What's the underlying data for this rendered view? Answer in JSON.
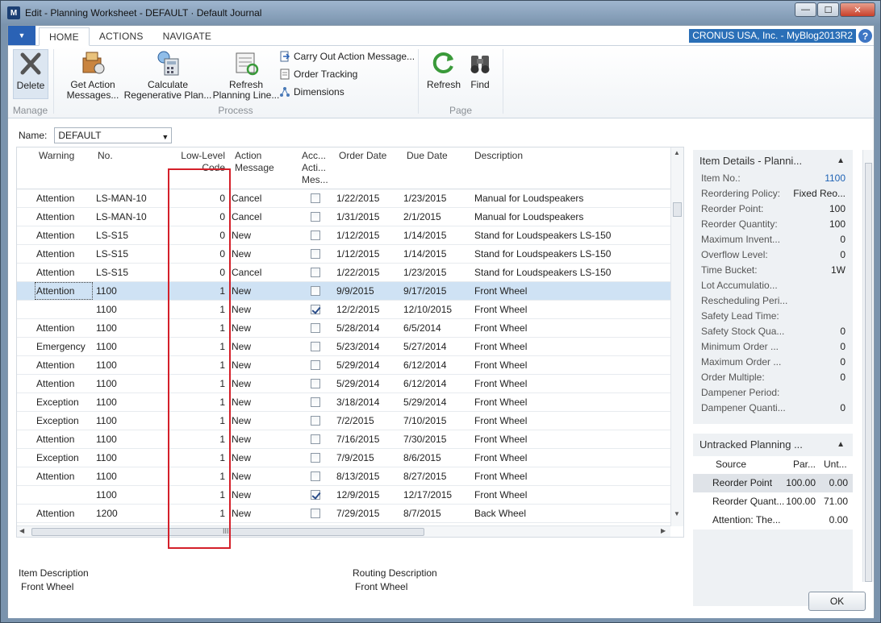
{
  "window": {
    "title": "Edit - Planning Worksheet - DEFAULT · Default Journal",
    "minimize": "—",
    "maximize": "☐",
    "close": "✕"
  },
  "tabs": [
    "HOME",
    "ACTIONS",
    "NAVIGATE"
  ],
  "company": "CRONUS USA, Inc. - MyBlog2013R2",
  "ribbon": {
    "delete": "Delete",
    "manage_label": "Manage",
    "get_action_1": "Get Action",
    "get_action_2": "Messages...",
    "calc_regen_1": "Calculate",
    "calc_regen_2": "Regenerative Plan...",
    "refresh_lines_1": "Refresh",
    "refresh_lines_2": "Planning Line...",
    "carry_out": "Carry Out Action Message...",
    "order_tracking": "Order Tracking",
    "dimensions": "Dimensions",
    "process_label": "Process",
    "refresh": "Refresh",
    "find": "Find",
    "page_label": "Page"
  },
  "name_filter": {
    "label": "Name:",
    "value": "DEFAULT"
  },
  "grid": {
    "headers": {
      "warning": "Warning",
      "no": "No.",
      "low_level_1": "Low-Level",
      "low_level_2": "Code",
      "action_1": "Action",
      "action_2": "Message",
      "accept_1": "Acc...",
      "accept_2": "Acti...",
      "accept_3": "Mes...",
      "order_date": "Order Date",
      "due_date": "Due Date",
      "description": "Description"
    },
    "rows": [
      {
        "warning": "Attention",
        "no": "LS-MAN-10",
        "llc": "0",
        "action": "Cancel",
        "accept": false,
        "order": "1/22/2015",
        "due": "1/23/2015",
        "desc": "Manual for Loudspeakers",
        "selected": false
      },
      {
        "warning": "Attention",
        "no": "LS-MAN-10",
        "llc": "0",
        "action": "Cancel",
        "accept": false,
        "order": "1/31/2015",
        "due": "2/1/2015",
        "desc": "Manual for Loudspeakers",
        "selected": false
      },
      {
        "warning": "Attention",
        "no": "LS-S15",
        "llc": "0",
        "action": "New",
        "accept": false,
        "order": "1/12/2015",
        "due": "1/14/2015",
        "desc": "Stand for Loudspeakers LS-150",
        "selected": false
      },
      {
        "warning": "Attention",
        "no": "LS-S15",
        "llc": "0",
        "action": "New",
        "accept": false,
        "order": "1/12/2015",
        "due": "1/14/2015",
        "desc": "Stand for Loudspeakers LS-150",
        "selected": false
      },
      {
        "warning": "Attention",
        "no": "LS-S15",
        "llc": "0",
        "action": "Cancel",
        "accept": false,
        "order": "1/22/2015",
        "due": "1/23/2015",
        "desc": "Stand for Loudspeakers LS-150",
        "selected": false
      },
      {
        "warning": "Attention",
        "no": "1100",
        "llc": "1",
        "action": "New",
        "accept": false,
        "order": "9/9/2015",
        "due": "9/17/2015",
        "desc": "Front Wheel",
        "selected": true
      },
      {
        "warning": "",
        "no": "1100",
        "llc": "1",
        "action": "New",
        "accept": true,
        "order": "12/2/2015",
        "due": "12/10/2015",
        "desc": "Front Wheel",
        "selected": false
      },
      {
        "warning": "Attention",
        "no": "1100",
        "llc": "1",
        "action": "New",
        "accept": false,
        "order": "5/28/2014",
        "due": "6/5/2014",
        "desc": "Front Wheel",
        "selected": false
      },
      {
        "warning": "Emergency",
        "no": "1100",
        "llc": "1",
        "action": "New",
        "accept": false,
        "order": "5/23/2014",
        "due": "5/27/2014",
        "desc": "Front Wheel",
        "selected": false
      },
      {
        "warning": "Attention",
        "no": "1100",
        "llc": "1",
        "action": "New",
        "accept": false,
        "order": "5/29/2014",
        "due": "6/12/2014",
        "desc": "Front Wheel",
        "selected": false
      },
      {
        "warning": "Attention",
        "no": "1100",
        "llc": "1",
        "action": "New",
        "accept": false,
        "order": "5/29/2014",
        "due": "6/12/2014",
        "desc": "Front Wheel",
        "selected": false
      },
      {
        "warning": "Exception",
        "no": "1100",
        "llc": "1",
        "action": "New",
        "accept": false,
        "order": "3/18/2014",
        "due": "5/29/2014",
        "desc": "Front Wheel",
        "selected": false
      },
      {
        "warning": "Exception",
        "no": "1100",
        "llc": "1",
        "action": "New",
        "accept": false,
        "order": "7/2/2015",
        "due": "7/10/2015",
        "desc": "Front Wheel",
        "selected": false
      },
      {
        "warning": "Attention",
        "no": "1100",
        "llc": "1",
        "action": "New",
        "accept": false,
        "order": "7/16/2015",
        "due": "7/30/2015",
        "desc": "Front Wheel",
        "selected": false
      },
      {
        "warning": "Exception",
        "no": "1100",
        "llc": "1",
        "action": "New",
        "accept": false,
        "order": "7/9/2015",
        "due": "8/6/2015",
        "desc": "Front Wheel",
        "selected": false
      },
      {
        "warning": "Attention",
        "no": "1100",
        "llc": "1",
        "action": "New",
        "accept": false,
        "order": "8/13/2015",
        "due": "8/27/2015",
        "desc": "Front Wheel",
        "selected": false
      },
      {
        "warning": "",
        "no": "1100",
        "llc": "1",
        "action": "New",
        "accept": true,
        "order": "12/9/2015",
        "due": "12/17/2015",
        "desc": "Front Wheel",
        "selected": false
      },
      {
        "warning": "Attention",
        "no": "1200",
        "llc": "1",
        "action": "New",
        "accept": false,
        "order": "7/29/2015",
        "due": "8/7/2015",
        "desc": "Back Wheel",
        "selected": false
      }
    ],
    "hscroll_grip": "III"
  },
  "footer": {
    "item_desc_label": "Item Description",
    "item_desc_value": "Front Wheel",
    "routing_desc_label": "Routing Description",
    "routing_desc_value": "Front Wheel"
  },
  "item_details": {
    "title": "Item Details - Planni...",
    "rows": [
      {
        "k": "Item No.:",
        "v": "1100",
        "link": true
      },
      {
        "k": "Reordering Policy:",
        "v": "Fixed Reo...",
        "link": false
      },
      {
        "k": "Reorder Point:",
        "v": "100",
        "link": false
      },
      {
        "k": "Reorder Quantity:",
        "v": "100",
        "link": false
      },
      {
        "k": "Maximum Invent...",
        "v": "0",
        "link": false
      },
      {
        "k": "Overflow Level:",
        "v": "0",
        "link": false
      },
      {
        "k": "Time Bucket:",
        "v": "1W",
        "link": false
      },
      {
        "k": "Lot Accumulatio...",
        "v": "",
        "link": false
      },
      {
        "k": "Rescheduling Peri...",
        "v": "",
        "link": false
      },
      {
        "k": "Safety Lead Time:",
        "v": "",
        "link": false
      },
      {
        "k": "Safety Stock Qua...",
        "v": "0",
        "link": false
      },
      {
        "k": "Minimum Order ...",
        "v": "0",
        "link": false
      },
      {
        "k": "Maximum Order ...",
        "v": "0",
        "link": false
      },
      {
        "k": "Order Multiple:",
        "v": "0",
        "link": false
      },
      {
        "k": "Dampener Period:",
        "v": "",
        "link": false
      },
      {
        "k": "Dampener Quanti...",
        "v": "0",
        "link": false
      }
    ]
  },
  "untracked": {
    "title": "Untracked Planning ...",
    "headers": {
      "source": "Source",
      "par": "Par...",
      "unt": "Unt..."
    },
    "rows": [
      {
        "source": "Reorder Point",
        "par": "100.00",
        "unt": "0.00",
        "selected": true
      },
      {
        "source": "Reorder Quant...",
        "par": "100.00",
        "unt": "71.00",
        "selected": false
      },
      {
        "source": "Attention: The...",
        "par": "",
        "unt": "0.00",
        "selected": false
      }
    ]
  },
  "ok": "OK",
  "colors": {
    "accent": "#2a62b5",
    "highlight": "#d4202a",
    "selected_row": "#cfe2f4"
  }
}
